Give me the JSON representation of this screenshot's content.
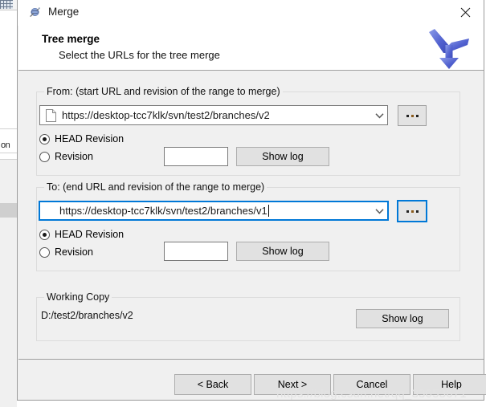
{
  "window": {
    "title": "Merge",
    "icon": "merge-app-icon",
    "close_label": "✕"
  },
  "header": {
    "title": "Tree merge",
    "subtitle": "Select the URLs for the tree merge",
    "logo_icon": "merge-arrows-icon"
  },
  "from_group": {
    "legend": "From: (start URL and revision of the range to merge)",
    "url": "https://desktop-tcc7klk/svn/test2/branches/v2",
    "browse_label": "...",
    "head_revision_label": "HEAD Revision",
    "head_revision_selected": true,
    "revision_label": "Revision",
    "revision_selected": false,
    "revision_value": "",
    "show_log_label": "Show log"
  },
  "to_group": {
    "legend": "To: (end URL and revision of the range to merge)",
    "url": "https://desktop-tcc7klk/svn/test2/branches/v1",
    "browse_label": "...",
    "head_revision_label": "HEAD Revision",
    "head_revision_selected": true,
    "revision_label": "Revision",
    "revision_selected": false,
    "revision_value": "",
    "show_log_label": "Show log"
  },
  "working_copy": {
    "legend": "Working Copy",
    "path": "D:/test2/branches/v2",
    "show_log_label": "Show log"
  },
  "footer": {
    "back_label": "< Back",
    "next_label": "Next >",
    "cancel_label": "Cancel",
    "help_label": "Help"
  },
  "watermark": {
    "text": "https://blog.csdn.net/qq_33053671"
  },
  "colors": {
    "focus_blue": "#0078d7",
    "dialog_bg": "#f0f0f0",
    "button_bg": "#e1e1e1"
  }
}
